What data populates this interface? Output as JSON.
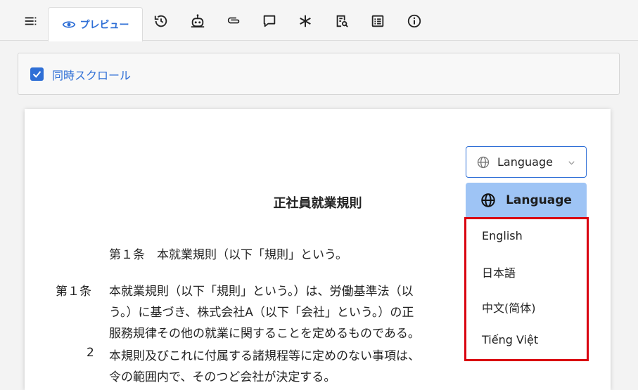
{
  "toolbar": {
    "preview_tab_label": "プレビュー",
    "icons": [
      "menu-icon",
      "eye-icon",
      "history-icon",
      "robot-icon",
      "attachment-icon",
      "comment-icon",
      "asterisk-icon",
      "search-document-icon",
      "list-icon",
      "info-icon"
    ]
  },
  "sync_scroll": {
    "label": "同時スクロール",
    "checked": true
  },
  "document": {
    "title": "正社員就業規則",
    "lines": [
      "第１条　本就業規則（以下「規則」という。",
      "第１条",
      "本就業規則（以下「規則」という。）は、労働基準法（以",
      "う。）に基づき、株式会社A（以下「会社」という。）の正",
      "服務規律その他の就業に関することを定めるものである。",
      "2",
      "本規則及びこれに付属する諸規程等に定めのない事項は、",
      "令の範囲内で、そのつど会社が決定する。"
    ]
  },
  "language": {
    "select_label": "Language",
    "menu_header": "Language",
    "options": [
      "English",
      "日本語",
      "中文(简体)",
      "Tiếng Việt"
    ]
  },
  "colors": {
    "accent": "#2f6fd6",
    "menu_header_bg": "#9ec4f5",
    "highlight_border": "#d9000f"
  }
}
